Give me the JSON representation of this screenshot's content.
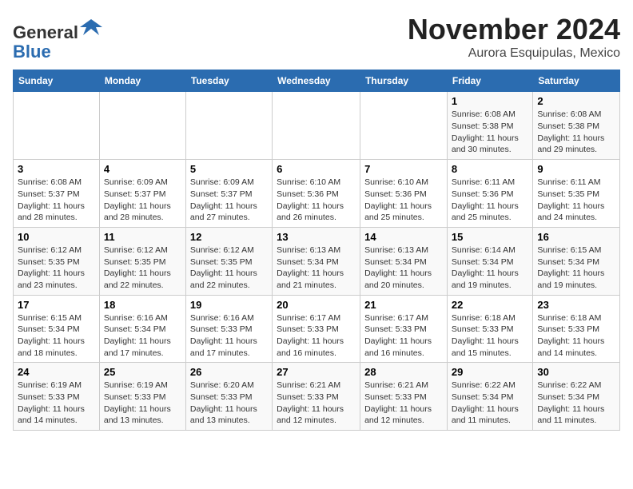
{
  "logo": {
    "line1": "General",
    "line2": "Blue"
  },
  "title": "November 2024",
  "subtitle": "Aurora Esquipulas, Mexico",
  "days_of_week": [
    "Sunday",
    "Monday",
    "Tuesday",
    "Wednesday",
    "Thursday",
    "Friday",
    "Saturday"
  ],
  "weeks": [
    [
      {
        "day": "",
        "info": ""
      },
      {
        "day": "",
        "info": ""
      },
      {
        "day": "",
        "info": ""
      },
      {
        "day": "",
        "info": ""
      },
      {
        "day": "",
        "info": ""
      },
      {
        "day": "1",
        "info": "Sunrise: 6:08 AM\nSunset: 5:38 PM\nDaylight: 11 hours and 30 minutes."
      },
      {
        "day": "2",
        "info": "Sunrise: 6:08 AM\nSunset: 5:38 PM\nDaylight: 11 hours and 29 minutes."
      }
    ],
    [
      {
        "day": "3",
        "info": "Sunrise: 6:08 AM\nSunset: 5:37 PM\nDaylight: 11 hours and 28 minutes."
      },
      {
        "day": "4",
        "info": "Sunrise: 6:09 AM\nSunset: 5:37 PM\nDaylight: 11 hours and 28 minutes."
      },
      {
        "day": "5",
        "info": "Sunrise: 6:09 AM\nSunset: 5:37 PM\nDaylight: 11 hours and 27 minutes."
      },
      {
        "day": "6",
        "info": "Sunrise: 6:10 AM\nSunset: 5:36 PM\nDaylight: 11 hours and 26 minutes."
      },
      {
        "day": "7",
        "info": "Sunrise: 6:10 AM\nSunset: 5:36 PM\nDaylight: 11 hours and 25 minutes."
      },
      {
        "day": "8",
        "info": "Sunrise: 6:11 AM\nSunset: 5:36 PM\nDaylight: 11 hours and 25 minutes."
      },
      {
        "day": "9",
        "info": "Sunrise: 6:11 AM\nSunset: 5:35 PM\nDaylight: 11 hours and 24 minutes."
      }
    ],
    [
      {
        "day": "10",
        "info": "Sunrise: 6:12 AM\nSunset: 5:35 PM\nDaylight: 11 hours and 23 minutes."
      },
      {
        "day": "11",
        "info": "Sunrise: 6:12 AM\nSunset: 5:35 PM\nDaylight: 11 hours and 22 minutes."
      },
      {
        "day": "12",
        "info": "Sunrise: 6:12 AM\nSunset: 5:35 PM\nDaylight: 11 hours and 22 minutes."
      },
      {
        "day": "13",
        "info": "Sunrise: 6:13 AM\nSunset: 5:34 PM\nDaylight: 11 hours and 21 minutes."
      },
      {
        "day": "14",
        "info": "Sunrise: 6:13 AM\nSunset: 5:34 PM\nDaylight: 11 hours and 20 minutes."
      },
      {
        "day": "15",
        "info": "Sunrise: 6:14 AM\nSunset: 5:34 PM\nDaylight: 11 hours and 19 minutes."
      },
      {
        "day": "16",
        "info": "Sunrise: 6:15 AM\nSunset: 5:34 PM\nDaylight: 11 hours and 19 minutes."
      }
    ],
    [
      {
        "day": "17",
        "info": "Sunrise: 6:15 AM\nSunset: 5:34 PM\nDaylight: 11 hours and 18 minutes."
      },
      {
        "day": "18",
        "info": "Sunrise: 6:16 AM\nSunset: 5:34 PM\nDaylight: 11 hours and 17 minutes."
      },
      {
        "day": "19",
        "info": "Sunrise: 6:16 AM\nSunset: 5:33 PM\nDaylight: 11 hours and 17 minutes."
      },
      {
        "day": "20",
        "info": "Sunrise: 6:17 AM\nSunset: 5:33 PM\nDaylight: 11 hours and 16 minutes."
      },
      {
        "day": "21",
        "info": "Sunrise: 6:17 AM\nSunset: 5:33 PM\nDaylight: 11 hours and 16 minutes."
      },
      {
        "day": "22",
        "info": "Sunrise: 6:18 AM\nSunset: 5:33 PM\nDaylight: 11 hours and 15 minutes."
      },
      {
        "day": "23",
        "info": "Sunrise: 6:18 AM\nSunset: 5:33 PM\nDaylight: 11 hours and 14 minutes."
      }
    ],
    [
      {
        "day": "24",
        "info": "Sunrise: 6:19 AM\nSunset: 5:33 PM\nDaylight: 11 hours and 14 minutes."
      },
      {
        "day": "25",
        "info": "Sunrise: 6:19 AM\nSunset: 5:33 PM\nDaylight: 11 hours and 13 minutes."
      },
      {
        "day": "26",
        "info": "Sunrise: 6:20 AM\nSunset: 5:33 PM\nDaylight: 11 hours and 13 minutes."
      },
      {
        "day": "27",
        "info": "Sunrise: 6:21 AM\nSunset: 5:33 PM\nDaylight: 11 hours and 12 minutes."
      },
      {
        "day": "28",
        "info": "Sunrise: 6:21 AM\nSunset: 5:33 PM\nDaylight: 11 hours and 12 minutes."
      },
      {
        "day": "29",
        "info": "Sunrise: 6:22 AM\nSunset: 5:34 PM\nDaylight: 11 hours and 11 minutes."
      },
      {
        "day": "30",
        "info": "Sunrise: 6:22 AM\nSunset: 5:34 PM\nDaylight: 11 hours and 11 minutes."
      }
    ]
  ]
}
